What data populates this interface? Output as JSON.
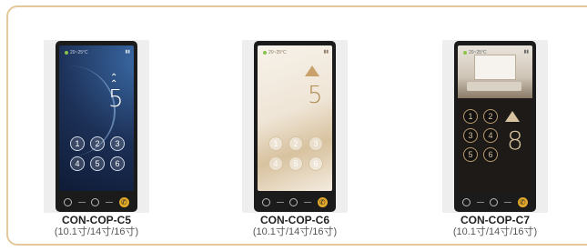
{
  "products": [
    {
      "model": "CON-COP-C5",
      "sizes": "(10.1寸/14寸/16寸)",
      "floor": "5",
      "temp": "20~25°C",
      "keys": [
        "1",
        "2",
        "3",
        "4",
        "5",
        "6"
      ]
    },
    {
      "model": "CON-COP-C6",
      "sizes": "(10.1寸/14寸/16寸)",
      "floor": "5",
      "temp": "20~25°C",
      "keys": [
        "1",
        "2",
        "3",
        "4",
        "5",
        "6"
      ]
    },
    {
      "model": "CON-COP-C7",
      "sizes": "(10.1寸/14寸/16寸)",
      "floor": "8",
      "temp": "20~25°C",
      "keys": [
        "1",
        "2",
        "3",
        "4",
        "5",
        "6"
      ]
    }
  ],
  "colors": {
    "border": "#e5c89a",
    "call": "#e3a92b",
    "c5_screen": "#2f5686",
    "c6_screen": "#f2ebe0",
    "c7_screen": "#1e1a17"
  }
}
